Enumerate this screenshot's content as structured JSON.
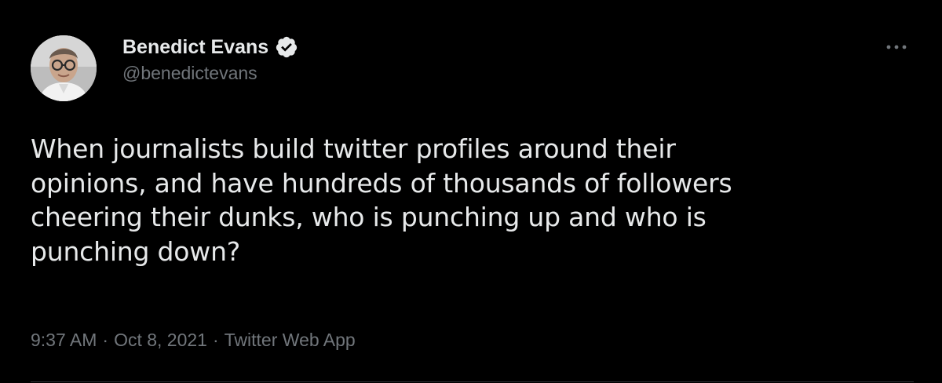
{
  "tweet": {
    "author": {
      "display_name": "Benedict Evans",
      "handle": "@benedictevans",
      "verified": true
    },
    "text": "When journalists build twitter profiles around their\nopinions, and have hundreds of thousands of followers\ncheering their dunks, who is punching up and who is\npunching down?",
    "meta": {
      "time": "9:37 AM",
      "date": "Oct 8, 2021",
      "source": "Twitter Web App",
      "separator": "·"
    },
    "icons": {
      "verified": "verified-badge-icon",
      "more": "more-options-icon"
    }
  },
  "colors": {
    "background": "#000000",
    "primary_text": "#e7e9ea",
    "secondary_text": "#71767b",
    "divider": "#2f3336"
  }
}
